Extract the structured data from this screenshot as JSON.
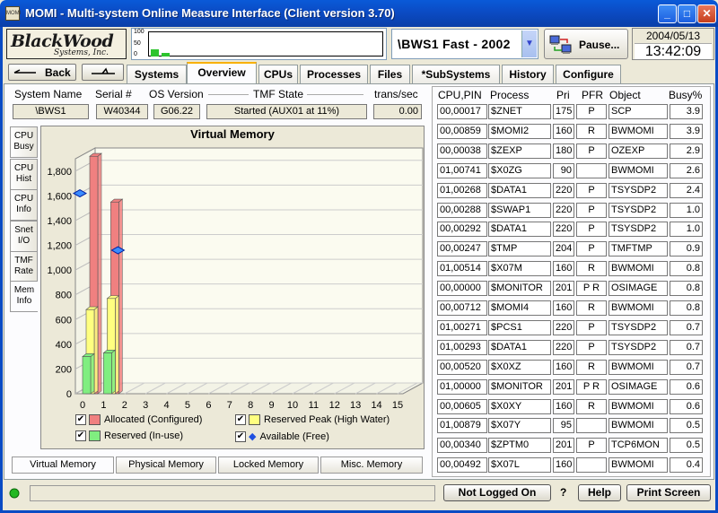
{
  "window": {
    "title": "MOMI - Multi-system Online Measure Interface (Client version 3.70)",
    "icon_label": "MOMI",
    "minimize": "_",
    "maximize": "□",
    "close": "✕"
  },
  "logo": {
    "line1": "BlackWood",
    "line2": "Systems, Inc."
  },
  "sparkline": {
    "labels": [
      "100",
      "50",
      "0"
    ]
  },
  "node_select": {
    "value": "\\BWS1 Fast - 2002"
  },
  "pause_label": "Pause...",
  "clock": {
    "date": "2004/05/13",
    "time": "13:42:09"
  },
  "nav": {
    "back_label": "Back",
    "forward_label": ""
  },
  "tabs": [
    "Systems",
    "Overview",
    "CPUs",
    "Processes",
    "Files",
    "*SubSystems",
    "History",
    "Configure"
  ],
  "active_tab": "Overview",
  "system_header": {
    "labels": [
      "System Name",
      "Serial #",
      "OS Version",
      "TMF State",
      "trans/sec"
    ],
    "values": [
      "\\BWS1",
      "W40344",
      "G06.22",
      "Started (AUX01 at 11%)",
      "0.00"
    ]
  },
  "side_tabs": [
    {
      "line1": "CPU",
      "line2": "Busy"
    },
    {
      "line1": "CPU",
      "line2": "Hist"
    },
    {
      "line1": "CPU",
      "line2": "Info"
    },
    {
      "line1": "Snet",
      "line2": "I/O"
    },
    {
      "line1": "TMF",
      "line2": "Rate"
    },
    {
      "line1": "Mem",
      "line2": "Info"
    }
  ],
  "chart_data": {
    "type": "bar",
    "title": "Virtual Memory",
    "x": [
      0,
      1,
      2,
      3,
      4,
      5,
      6,
      7,
      8,
      9,
      10,
      11,
      12,
      13,
      14,
      15
    ],
    "y_ticks": [
      0,
      200,
      400,
      600,
      800,
      "1,000",
      "1,200",
      "1,400",
      "1,600",
      "1,800"
    ],
    "ylim": [
      0,
      1900
    ],
    "series": [
      {
        "name": "Allocated (Configured)",
        "color": "#f08080",
        "values": [
          1920,
          1550
        ]
      },
      {
        "name": "Reserved Peak (High Water)",
        "color": "#ffff80",
        "values": [
          680,
          770
        ]
      },
      {
        "name": "Reserved (In-use)",
        "color": "#80ee80",
        "values": [
          300,
          330
        ]
      },
      {
        "name": "Available (Free)",
        "color": "#3070ff",
        "values": [
          1620,
          1160
        ]
      }
    ],
    "legend_checked": [
      true,
      true,
      true,
      true
    ],
    "grid": true
  },
  "bottom_tabs": [
    "Virtual Memory",
    "Physical Memory",
    "Locked Memory",
    "Misc. Memory"
  ],
  "process_table": {
    "headers": [
      "CPU,PIN",
      "Process",
      "Pri",
      "PFR",
      "Object",
      "Busy%"
    ],
    "rows": [
      [
        "00,00017",
        "$ZNET",
        "175",
        "P",
        "SCP",
        "3.9"
      ],
      [
        "00,00859",
        "$MOMI2",
        "160",
        "R",
        "BWMOMI",
        "3.9"
      ],
      [
        "00,00038",
        "$ZEXP",
        "180",
        "P",
        "OZEXP",
        "2.9"
      ],
      [
        "01,00741",
        "$X0ZG",
        "90",
        "",
        "BWMOMI",
        "2.6"
      ],
      [
        "01,00268",
        "$DATA1",
        "220",
        "P",
        "TSYSDP2",
        "2.4"
      ],
      [
        "00,00288",
        "$SWAP1",
        "220",
        "P",
        "TSYSDP2",
        "1.0"
      ],
      [
        "00,00292",
        "$DATA1",
        "220",
        "P",
        "TSYSDP2",
        "1.0"
      ],
      [
        "00,00247",
        "$TMP",
        "204",
        "P",
        "TMFTMP",
        "0.9"
      ],
      [
        "01,00514",
        "$X07M",
        "160",
        "R",
        "BWMOMI",
        "0.8"
      ],
      [
        "00,00000",
        "$MONITOR",
        "201",
        "P R",
        "OSIMAGE",
        "0.8"
      ],
      [
        "00,00712",
        "$MOMI4",
        "160",
        "R",
        "BWMOMI",
        "0.8"
      ],
      [
        "01,00271",
        "$PCS1",
        "220",
        "P",
        "TSYSDP2",
        "0.7"
      ],
      [
        "01,00293",
        "$DATA1",
        "220",
        "P",
        "TSYSDP2",
        "0.7"
      ],
      [
        "00,00520",
        "$X0XZ",
        "160",
        "R",
        "BWMOMI",
        "0.7"
      ],
      [
        "01,00000",
        "$MONITOR",
        "201",
        "P R",
        "OSIMAGE",
        "0.6"
      ],
      [
        "00,00605",
        "$X0XY",
        "160",
        "R",
        "BWMOMI",
        "0.6"
      ],
      [
        "01,00879",
        "$X07Y",
        "95",
        "",
        "BWMOMI",
        "0.5"
      ],
      [
        "00,00340",
        "$ZPTM0",
        "201",
        "P",
        "TCP6MON",
        "0.5"
      ],
      [
        "00,00492",
        "$X07L",
        "160",
        "",
        "BWMOMI",
        "0.4"
      ]
    ]
  },
  "footer": {
    "login_status": "Not Logged On",
    "question": "?",
    "help": "Help",
    "print": "Print Screen"
  }
}
